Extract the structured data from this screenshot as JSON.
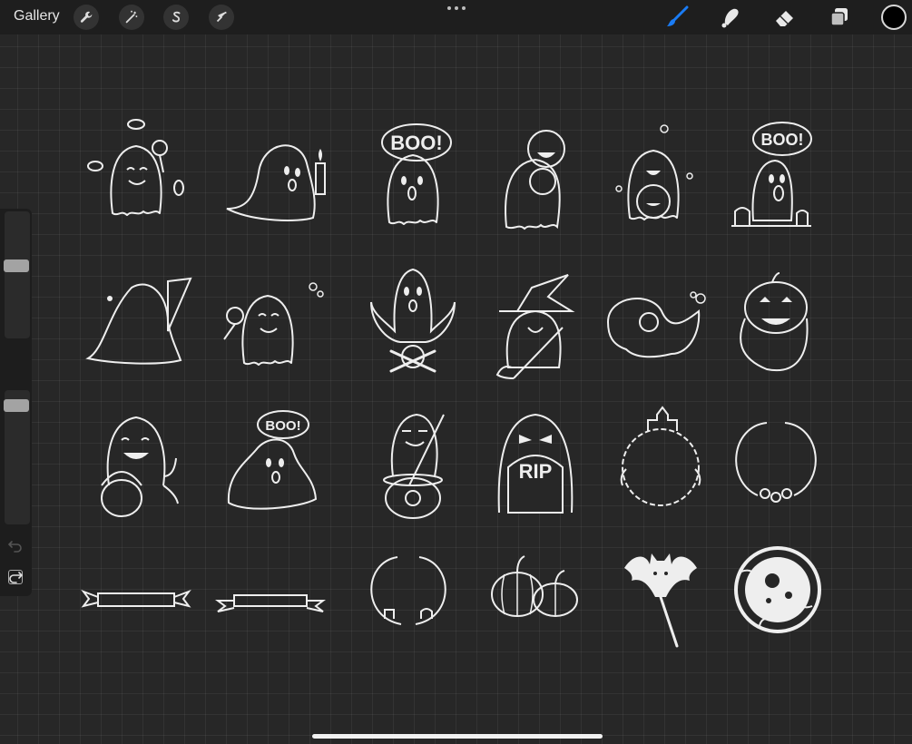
{
  "toolbar": {
    "gallery_label": "Gallery",
    "left_tools": [
      {
        "name": "actions",
        "icon": "wrench-icon"
      },
      {
        "name": "adjustments",
        "icon": "magic-wand-icon"
      },
      {
        "name": "selection",
        "icon": "selection-s-icon"
      },
      {
        "name": "transform",
        "icon": "arrow-cursor-icon"
      }
    ],
    "right_tools": [
      {
        "name": "brush",
        "icon": "brush-icon",
        "active": true
      },
      {
        "name": "smudge",
        "icon": "smudge-icon"
      },
      {
        "name": "eraser",
        "icon": "eraser-icon"
      },
      {
        "name": "layers",
        "icon": "layers-icon"
      }
    ],
    "accent_color": "#1a7cf5",
    "current_color": "#000000"
  },
  "sidebar": {
    "brush_size": 0.2,
    "opacity": 0.93,
    "undo_icon": "undo-icon",
    "redo_icon": "redo-icon",
    "modify_icon": "square-icon"
  },
  "canvas": {
    "stickers": {
      "row1": [
        "ghost-with-candies",
        "ghost-with-candle",
        "ghost-boo-speech",
        "ghost-with-pumpkins",
        "ghost-with-pumpkin-bucket",
        "ghost-boo-graves"
      ],
      "row2": [
        "ghost-with-knife",
        "ghost-with-lollipop",
        "ghost-with-skull-crossbones",
        "ghost-witch-hat-broom",
        "ghost-floating",
        "jack-o-lantern-ghost"
      ],
      "row3": [
        "ghost-with-candy-basket",
        "ghost-boo-small",
        "ghost-with-cauldron",
        "ghost-with-rip-tombstone",
        "haunted-house-wreath",
        "floral-wreath"
      ],
      "row4": [
        "ribbon-banner",
        "ribbon-banner-2",
        "graveyard-wreath",
        "pumpkins",
        "bat-lollipop",
        "moon-badge"
      ]
    },
    "speech_text": "BOO!",
    "tombstone_text": "RIP"
  }
}
